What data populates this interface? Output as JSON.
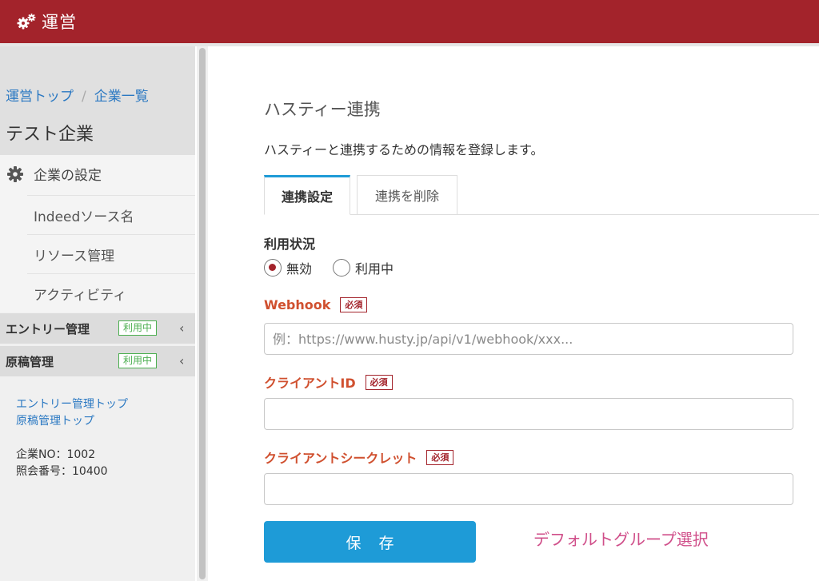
{
  "header": {
    "title": "運営",
    "icon": "gears-icon"
  },
  "sidebar": {
    "breadcrumb": [
      "運営トップ",
      "企業一覧"
    ],
    "breadcrumb_sep": "/",
    "company_name": "テスト企業",
    "settings": {
      "title": "企業の設定",
      "icon": "gear-icon",
      "items": [
        "Indeedソース名",
        "リソース管理",
        "アクティビティ"
      ]
    },
    "groups": [
      {
        "label": "エントリー管理",
        "badge": "利用中",
        "chevron": "‹"
      },
      {
        "label": "原稿管理",
        "badge": "利用中",
        "chevron": "‹"
      }
    ],
    "links": [
      "エントリー管理トップ",
      "原稿管理トップ"
    ],
    "info": [
      "企業NO：1002",
      "照会番号：10400"
    ]
  },
  "main": {
    "title": "ハスティー連携",
    "description": "ハスティーと連携するための情報を登録します。",
    "tabs": [
      {
        "label": "連携設定",
        "active": true
      },
      {
        "label": "連携を削除",
        "active": false
      }
    ],
    "status": {
      "label": "利用状況",
      "options": [
        {
          "label": "無効",
          "checked": true
        },
        {
          "label": "利用中",
          "checked": false
        }
      ]
    },
    "required_badge": "必須",
    "webhook": {
      "label": "Webhook",
      "value": "",
      "placeholder": "例：https://www.husty.jp/api/v1/webhook/xxx..."
    },
    "client_id": {
      "label": "クライアントID",
      "value": "",
      "placeholder": ""
    },
    "client_secret": {
      "label": "クライアントシークレット",
      "value": "",
      "placeholder": ""
    },
    "save_label": "保存",
    "default_group_link": "デフォルトグループ選択"
  },
  "colors": {
    "brand": "#a3232b",
    "primary_button": "#1e9bd7",
    "required": "#d0502f",
    "badge_green": "#4caf50",
    "link": "#2a78c2",
    "pink_link": "#d04f8a"
  }
}
